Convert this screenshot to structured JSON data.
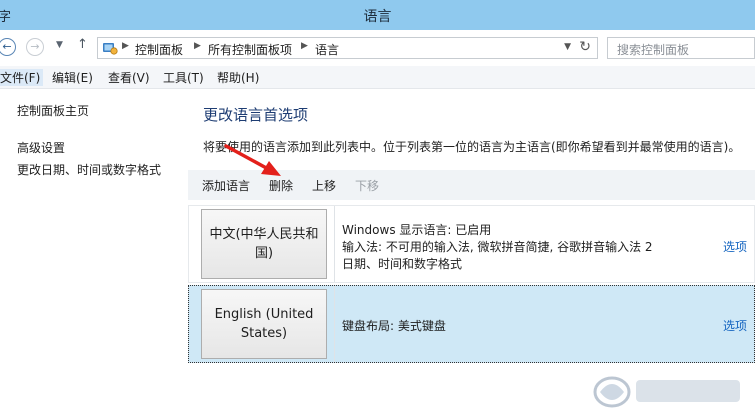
{
  "window": {
    "title": "语言",
    "app_glyph": "字"
  },
  "address_bar": {
    "breadcrumbs": [
      "控制面板",
      "所有控制面板项",
      "语言"
    ],
    "search_placeholder": "搜索控制面板"
  },
  "menu": [
    "文件(F)",
    "编辑(E)",
    "查看(V)",
    "工具(T)",
    "帮助(H)"
  ],
  "sidebar": [
    "控制面板主页",
    "高级设置",
    "更改日期、时间或数字格式"
  ],
  "main": {
    "heading": "更改语言首选项",
    "description": "将要使用的语言添加到此列表中。位于列表第一位的语言为主语言(即你希望看到并最常使用的语言)。",
    "toolbar": {
      "add": "添加语言",
      "remove": "删除",
      "up": "上移",
      "down": "下移"
    },
    "languages": [
      {
        "name": "中文(中华人民共和国)",
        "lines": [
          "Windows 显示语言: 已启用",
          "输入法: 不可用的输入法, 微软拼音简捷, 谷歌拼音输入法 2",
          "日期、时间和数字格式"
        ],
        "options": "选项"
      },
      {
        "name": "English (United States)",
        "lines": [
          "键盘布局: 美式键盘"
        ],
        "options": "选项"
      }
    ]
  },
  "colors": {
    "titlebar": "#8fc9ee",
    "heading": "#1e3d73",
    "selected_row": "#cfe8f6",
    "link": "#1565c0",
    "annotation_arrow": "#e3201b"
  }
}
